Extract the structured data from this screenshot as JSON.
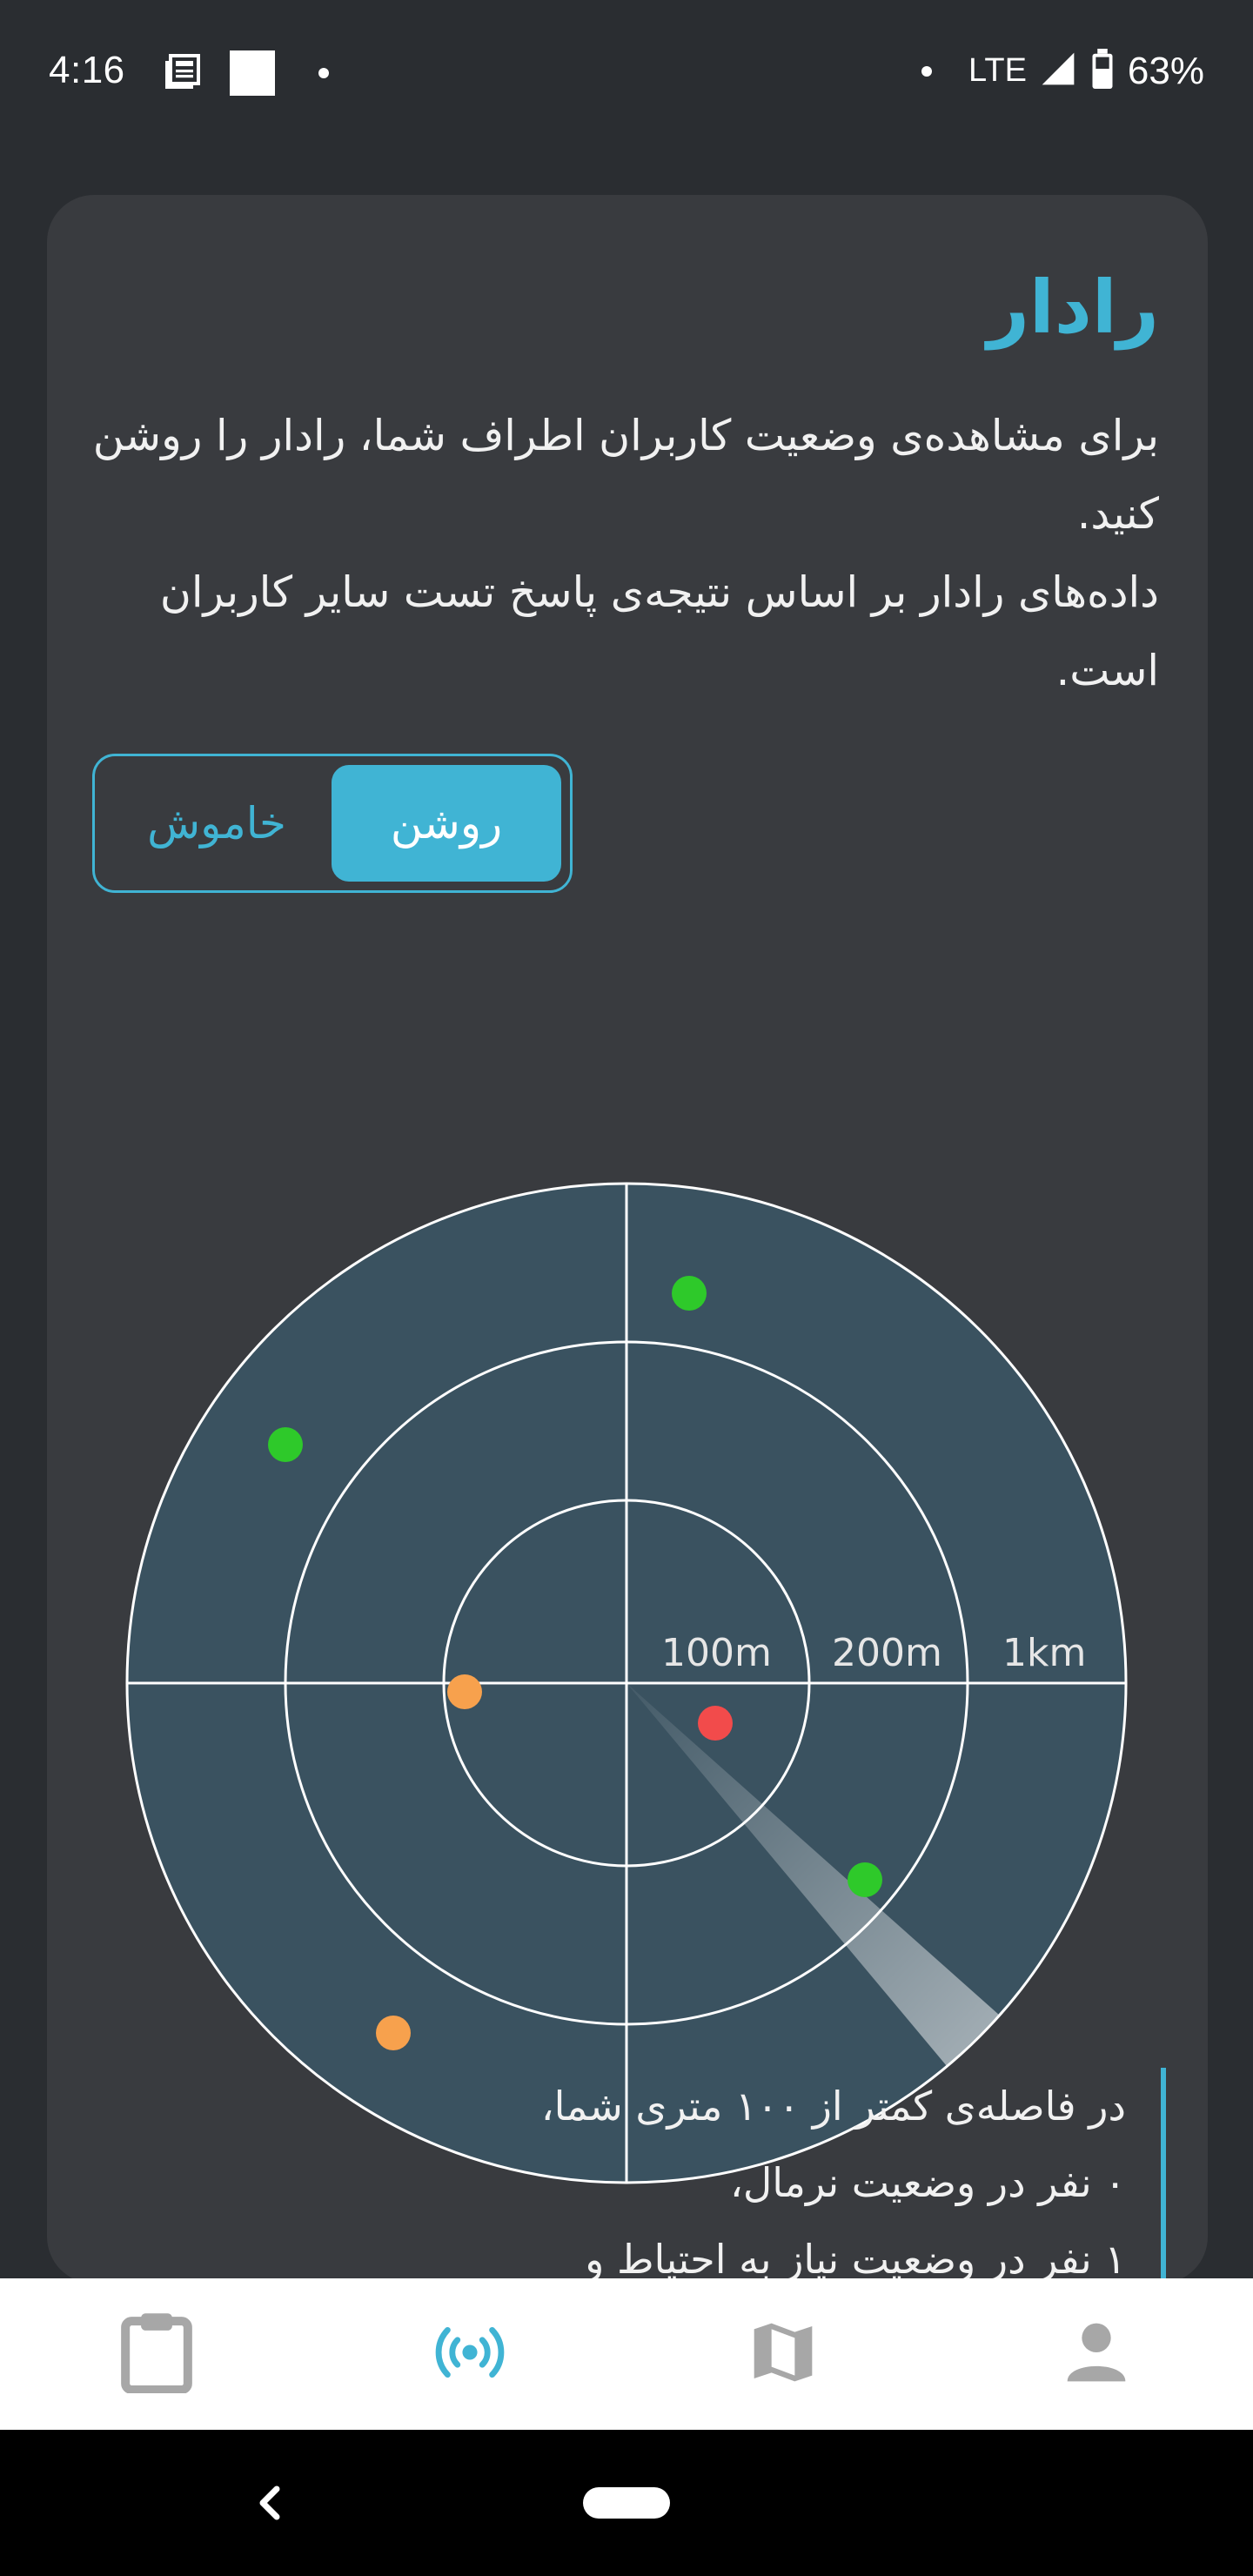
{
  "status_bar": {
    "time": "4:16",
    "network": "LTE",
    "battery": "63%",
    "icons": [
      "news-icon",
      "square-notification-icon",
      "dot-icon",
      "dot-icon",
      "signal-icon",
      "battery-icon"
    ]
  },
  "card": {
    "title": "رادار",
    "description_line1": "برای مشاهده‌ی وضعیت کاربران اطراف شما، رادار را روشن کنید.",
    "description_line2": "داده‌های رادار بر اساس نتیجه‌ی پاسخ تست سایر کاربران است."
  },
  "toggle": {
    "on_label": "روشن",
    "off_label": "خاموش",
    "selected": "on"
  },
  "radar": {
    "ring_labels": [
      "100m",
      "200m",
      "1km"
    ],
    "colors": {
      "background": "#3a5260",
      "lines": "#ffffff",
      "green": "#2ec92a",
      "orange": "#f7a14d",
      "red": "#f24b4b"
    },
    "points": [
      {
        "status": "green"
      },
      {
        "status": "green"
      },
      {
        "status": "orange"
      },
      {
        "status": "red"
      },
      {
        "status": "green"
      },
      {
        "status": "orange"
      }
    ]
  },
  "summary": {
    "line1": "در فاصله‌ی کمتر از ۱۰۰ متری شما،",
    "line2": "۰ نفر در وضعیت نرمال،",
    "line3": "۱ نفر در وضعیت نیاز به احتیاط و"
  },
  "bottom_nav": {
    "items": [
      {
        "icon": "clipboard-icon",
        "active": false
      },
      {
        "icon": "radar-icon",
        "active": true
      },
      {
        "icon": "map-icon",
        "active": false
      },
      {
        "icon": "person-icon",
        "active": false
      }
    ],
    "active_color": "#40b4d4",
    "inactive_color": "#a7a7a7"
  },
  "system_nav": {
    "icons": [
      "back-icon",
      "home-pill"
    ]
  }
}
